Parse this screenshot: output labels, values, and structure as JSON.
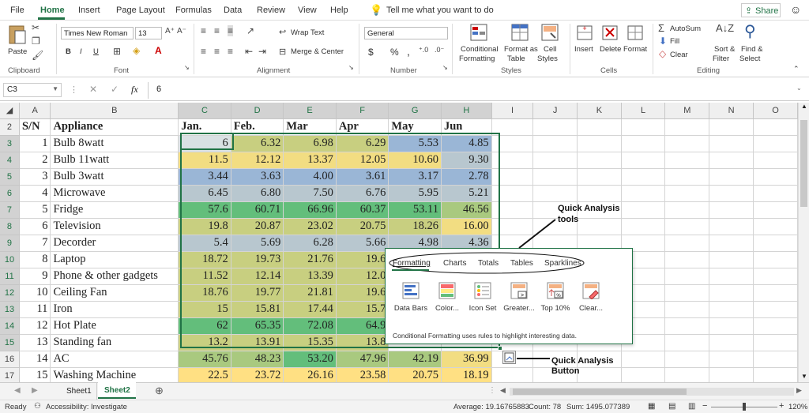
{
  "menu": {
    "tabs": [
      "File",
      "Home",
      "Insert",
      "Page Layout",
      "Formulas",
      "Data",
      "Review",
      "View",
      "Help"
    ],
    "tell_me": "Tell me what you want to do",
    "share": "Share"
  },
  "ribbon": {
    "clipboard": {
      "label": "Clipboard",
      "paste": "Paste"
    },
    "font": {
      "label": "Font",
      "family": "Times New Roman",
      "size": "13",
      "bold": "B",
      "italic": "I",
      "underline": "U"
    },
    "alignment": {
      "label": "Alignment",
      "wrap": "Wrap Text",
      "merge": "Merge & Center"
    },
    "number": {
      "label": "Number",
      "format": "General",
      "currency": "$",
      "percent": "%",
      "comma": ","
    },
    "styles": {
      "label": "Styles",
      "conditional": [
        "Conditional",
        "Formatting"
      ],
      "format_table": [
        "Format as",
        "Table"
      ],
      "cell_styles": [
        "Cell",
        "Styles"
      ]
    },
    "cells": {
      "label": "Cells",
      "insert": "Insert",
      "delete": "Delete",
      "format": "Format"
    },
    "editing": {
      "label": "Editing",
      "autosum": "AutoSum",
      "fill": "Fill",
      "clear": "Clear",
      "sort": [
        "Sort &",
        "Filter"
      ],
      "find": [
        "Find &",
        "Select"
      ]
    }
  },
  "formula_bar": {
    "name_box": "C3",
    "fx": "fx",
    "value": "6"
  },
  "columns": [
    "A",
    "B",
    "C",
    "D",
    "E",
    "F",
    "G",
    "H",
    "I",
    "J",
    "K",
    "L",
    "M",
    "N",
    "O"
  ],
  "rows": [
    {
      "n": "2",
      "a": "S/N",
      "b": "Appliance",
      "v": [
        "Jan.",
        "Feb.",
        "Mar",
        "Apr",
        "May",
        "Jun"
      ]
    },
    {
      "n": "3",
      "a": "1",
      "b": "Bulb 8watt",
      "v": [
        "6",
        "6.32",
        "6.98",
        "6.29",
        "5.53",
        "4.85"
      ]
    },
    {
      "n": "4",
      "a": "2",
      "b": "Bulb 11watt",
      "v": [
        "11.5",
        "12.12",
        "13.37",
        "12.05",
        "10.60",
        "9.30"
      ]
    },
    {
      "n": "5",
      "a": "3",
      "b": "Bulb 3watt",
      "v": [
        "3.44",
        "3.63",
        "4.00",
        "3.61",
        "3.17",
        "2.78"
      ]
    },
    {
      "n": "6",
      "a": "4",
      "b": "Microwave",
      "v": [
        "6.45",
        "6.80",
        "7.50",
        "6.76",
        "5.95",
        "5.21"
      ]
    },
    {
      "n": "7",
      "a": "5",
      "b": "Fridge",
      "v": [
        "57.6",
        "60.71",
        "66.96",
        "60.37",
        "53.11",
        "46.56"
      ]
    },
    {
      "n": "8",
      "a": "6",
      "b": "Television",
      "v": [
        "19.8",
        "20.87",
        "23.02",
        "20.75",
        "18.26",
        "16.00"
      ]
    },
    {
      "n": "9",
      "a": "7",
      "b": "Decorder",
      "v": [
        "5.4",
        "5.69",
        "6.28",
        "5.66",
        "4.98",
        "4.36"
      ]
    },
    {
      "n": "10",
      "a": "8",
      "b": "Laptop",
      "v": [
        "18.72",
        "19.73",
        "21.76",
        "19.6",
        "",
        ""
      ]
    },
    {
      "n": "11",
      "a": "9",
      "b": "Phone & other gadgets",
      "v": [
        "11.52",
        "12.14",
        "13.39",
        "12.0",
        "",
        ""
      ]
    },
    {
      "n": "12",
      "a": "10",
      "b": "Ceiling Fan",
      "v": [
        "18.76",
        "19.77",
        "21.81",
        "19.6",
        "",
        ""
      ]
    },
    {
      "n": "13",
      "a": "11",
      "b": "Iron",
      "v": [
        "15",
        "15.81",
        "17.44",
        "15.7",
        "",
        ""
      ]
    },
    {
      "n": "14",
      "a": "12",
      "b": "Hot Plate",
      "v": [
        "62",
        "65.35",
        "72.08",
        "64.9",
        "",
        ""
      ]
    },
    {
      "n": "15",
      "a": "13",
      "b": "Standing fan",
      "v": [
        "13.2",
        "13.91",
        "15.35",
        "13.8",
        "",
        ""
      ]
    },
    {
      "n": "16",
      "a": "14",
      "b": "AC",
      "v": [
        "45.76",
        "48.23",
        "53.20",
        "47.96",
        "42.19",
        "36.99"
      ]
    },
    {
      "n": "17",
      "a": "15",
      "b": "Washing Machine",
      "v": [
        "22.5",
        "23.72",
        "26.16",
        "23.58",
        "20.75",
        "18.19"
      ]
    }
  ],
  "quick_analysis": {
    "tabs": [
      "Formatting",
      "Charts",
      "Totals",
      "Tables",
      "Sparklines"
    ],
    "items": [
      "Data Bars",
      "Color...",
      "Icon Set",
      "Greater...",
      "Top 10%",
      "Clear..."
    ],
    "description": "Conditional Formatting uses rules to highlight interesting data."
  },
  "annotations": {
    "tools": [
      "Quick Analysis",
      "tools"
    ],
    "button": [
      "Quick Analysis",
      "Button"
    ]
  },
  "sheets": [
    "Sheet1",
    "Sheet2"
  ],
  "status": {
    "ready": "Ready",
    "accessibility": "Accessibility: Investigate",
    "average": "Average: 19.16765883",
    "count": "Count: 78",
    "sum": "Sum: 1495.077389",
    "zoom": "120%"
  },
  "colors": {
    "accent": "#217346",
    "green": "#63be7b",
    "yellow": "#ffeb84",
    "blue": "#9ab6d6"
  }
}
